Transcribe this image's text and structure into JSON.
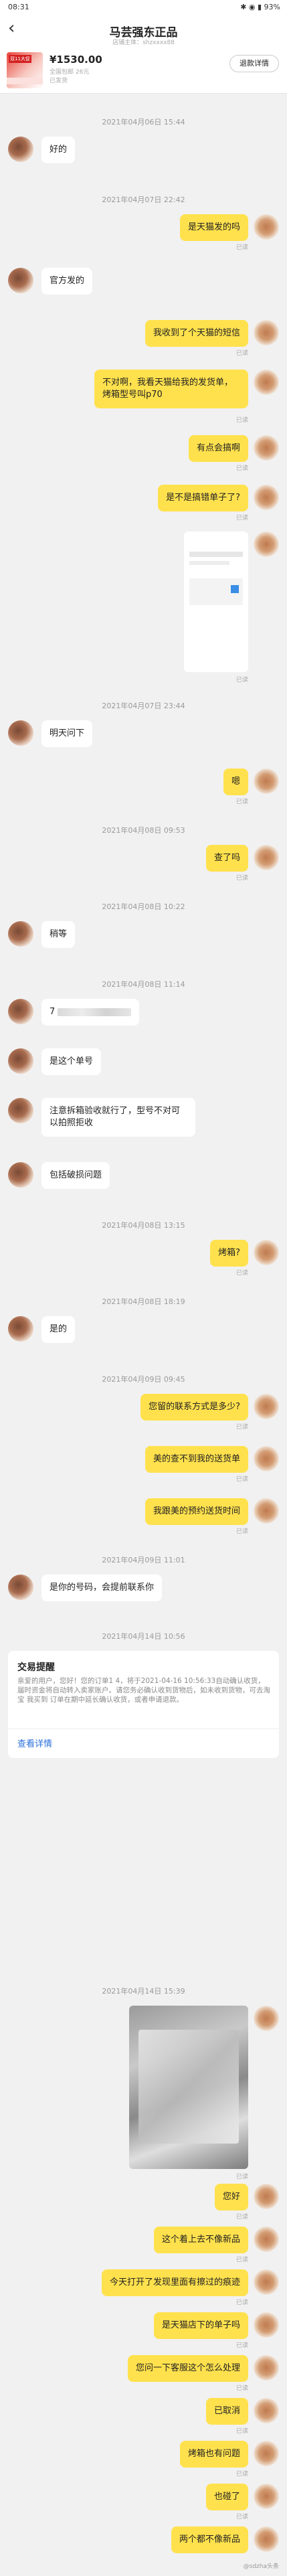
{
  "status": {
    "time": "08:31",
    "right": "✱ ◉ ▮ 93%"
  },
  "header": {
    "back": "‹",
    "shop_name": "马芸强东正品",
    "shop_sub": "店铺主体：shzxxxx88",
    "product": {
      "price": "¥1530.00",
      "meta1": "全国包邮 26元",
      "meta2": "已发货",
      "thumb_tag": "双11大促"
    },
    "detail_button": "退款详情"
  },
  "timestamps": {
    "t1": "2021年04月06日 15:44",
    "t2": "2021年04月07日 22:42",
    "t3": "2021年04月07日 23:44",
    "t4": "2021年04月08日 09:53",
    "t5": "2021年04月08日 10:22",
    "t6": "2021年04月08日 11:14",
    "t7": "2021年04月08日 13:15",
    "t8": "2021年04月08日 18:19",
    "t9": "2021年04月09日 09:45",
    "t10": "2021年04月09日 11:01",
    "t11": "2021年04月14日 10:56",
    "t12": "2021年04月14日 15:39"
  },
  "read_label": "已读",
  "messages": {
    "m1": "好的",
    "m2": "是天猫发的吗",
    "m3": "官方发的",
    "m4": "我收到了个天猫的短信",
    "m5": "不对啊，我看天猫给我的发货单，烤箱型号叫p70",
    "m6": "有点会搞啊",
    "m7": "是不是搞错单子了?",
    "m8": "明天问下",
    "m9": "嗯",
    "m10": "查了吗",
    "m11": "稍等",
    "m12": "7",
    "m13": "是这个单号",
    "m14": "注意拆箱验收就行了，型号不对可以拍照拒收",
    "m15": "包括破损问题",
    "m16": "烤箱?",
    "m17": "是的",
    "m18": "您留的联系方式是多少?",
    "m19": "美的查不到我的送货单",
    "m20": "我跟美的预约送货时间",
    "m21": "是你的号码，会提前联系你",
    "m22": "您好",
    "m23": "这个着上去不像新品",
    "m24": "今天打开了发现里面有擦过的痕迹",
    "m25": "是天猫店下的单子吗",
    "m26": "您问一下客服这个怎么处理",
    "m27": "已取消",
    "m28": "烤箱也有问题",
    "m29": "也碰了",
    "m30": "两个都不像新品"
  },
  "card": {
    "title": "交易提醒",
    "text": "亲爱的用户，您好！您的订单1              4，将于2021-04-16 10:56:33自动确认收货，届时资金将自动转入卖家账户。请您务必确认收到货物后，如未收到货物，可去淘宝 我买到 订单在期中延长确认收货，或者申请退款。",
    "link": "查看详情"
  },
  "watermark": "@sdzha头条"
}
